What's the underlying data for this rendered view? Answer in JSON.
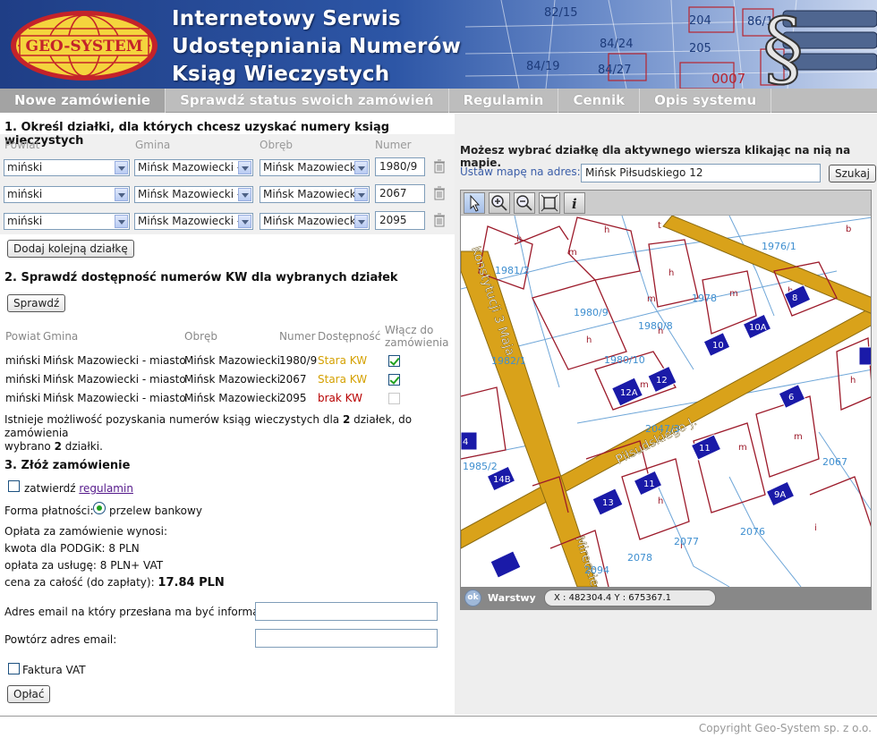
{
  "header": {
    "logo_text": "GEO-SYSTEM",
    "title_lines": [
      "Internetowy Serwis",
      "Udostępniania Numerów",
      "Ksiąg Wieczystych"
    ],
    "bg_numbers": [
      "82/15",
      "204",
      "86/1",
      "84/24",
      "205",
      "84/27",
      "0007",
      "84/19"
    ]
  },
  "nav": {
    "items": [
      {
        "label": "Nowe zamówienie",
        "active": true
      },
      {
        "label": "Sprawdź status swoich zamówień",
        "active": false
      },
      {
        "label": "Regulamin",
        "active": false
      },
      {
        "label": "Cennik",
        "active": false
      },
      {
        "label": "Opis systemu",
        "active": false
      }
    ]
  },
  "step1": {
    "title": "1. Określ działki, dla których chcesz uzyskać numery ksiąg wieczystych",
    "cols": {
      "powiat": "Powiat",
      "gmina": "Gmina",
      "obreb": "Obręb",
      "numer": "Numer"
    },
    "rows": [
      {
        "powiat": "miński",
        "gmina": "Mińsk Mazowiecki - ",
        "obreb": "Mińsk Mazowiecki",
        "numer": "1980/9"
      },
      {
        "powiat": "miński",
        "gmina": "Mińsk Mazowiecki - ",
        "obreb": "Mińsk Mazowiecki",
        "numer": "2067"
      },
      {
        "powiat": "miński",
        "gmina": "Mińsk Mazowiecki - ",
        "obreb": "Mińsk Mazowiecki",
        "numer": "2095"
      }
    ],
    "add_button": "Dodaj kolejną działkę"
  },
  "step2": {
    "title": "2. Sprawdź dostępność numerów KW dla wybranych działek",
    "check_button": "Sprawdź",
    "headers": {
      "powiat": "Powiat",
      "gmina": "Gmina",
      "obreb": "Obręb",
      "numer": "Numer",
      "dostepnosc": "Dostępność",
      "wlacz1": "Włącz do",
      "wlacz2": "zamówienia"
    },
    "rows": [
      {
        "powiat": "miński",
        "gmina": "Mińsk Mazowiecki - miasto",
        "obreb": "Mińsk Mazowiecki",
        "numer": "1980/9",
        "status": "Stara KW",
        "status_color": "#d4a000",
        "checked": true,
        "enabled": true
      },
      {
        "powiat": "miński",
        "gmina": "Mińsk Mazowiecki - miasto",
        "obreb": "Mińsk Mazowiecki",
        "numer": "2067",
        "status": "Stara KW",
        "status_color": "#d4a000",
        "checked": true,
        "enabled": true
      },
      {
        "powiat": "miński",
        "gmina": "Mińsk Mazowiecki - miasto",
        "obreb": "Mińsk Mazowiecki",
        "numer": "2095",
        "status": "brak KW",
        "status_color": "#b80000",
        "checked": false,
        "enabled": false
      }
    ],
    "info_a": "Istnieje możliwość pozyskania numerów ksiąg wieczystych dla ",
    "info_b": "2",
    "info_c": " działek, do zamówienia",
    "info_d": "wybrano ",
    "info_e": "2",
    "info_f": " działki."
  },
  "step3": {
    "title": "3. Złóż zamówienie",
    "confirm_label": "zatwierdź ",
    "confirm_link": "regulamin",
    "payment_label": "Forma płatności:",
    "payment_option": "przelew bankowy",
    "fee_intro": "Opłata za zamówienie wynosi:",
    "fee_podgik": "kwota dla PODGiK: 8 PLN",
    "fee_service": "opłata za usługę: 8 PLN+ VAT",
    "total_label": "cena za całość (do zapłaty): ",
    "total_value": "17.84 PLN",
    "email_label": "Adres email na który przesłana ma być informacja:",
    "email_value": "",
    "email2_label": "Powtórz adres email:",
    "email2_value": "",
    "vat_label": "Faktura VAT",
    "pay_button": "Opłać"
  },
  "map_panel": {
    "hint": "Możesz wybrać działkę dla aktywnego wiersza klikając na nią na mapie.",
    "address_label": "Ustaw mapę na adres:",
    "address_value": "Mińsk Piłsudskiego 12",
    "search_button": "Szukaj",
    "layers_label": "Warstwy",
    "ok_label": "ok",
    "coords": "X : 482304.4  Y : 675367.1",
    "street_labels": [
      "Piłsudskiego J.",
      "Konstytucji 3 Maja",
      "Mireckiego"
    ],
    "parcel_labels": [
      "1981/2",
      "1976/1",
      "1978",
      "1980/9",
      "1980/8",
      "1980/10",
      "1982/1",
      "2047/3",
      "1985/2",
      "2067",
      "2076",
      "2077",
      "2078",
      "2094"
    ],
    "building_labels": [
      "8",
      "10A",
      "10",
      "12A",
      "12",
      "6",
      "11",
      "13",
      "14B",
      "9A",
      "11",
      "4"
    ],
    "tools": [
      "pointer-icon",
      "zoom-in-icon",
      "zoom-out-icon",
      "full-extent-icon",
      "info-icon"
    ]
  },
  "footer": {
    "copyright": "Copyright Geo-System sp. z o.o."
  }
}
